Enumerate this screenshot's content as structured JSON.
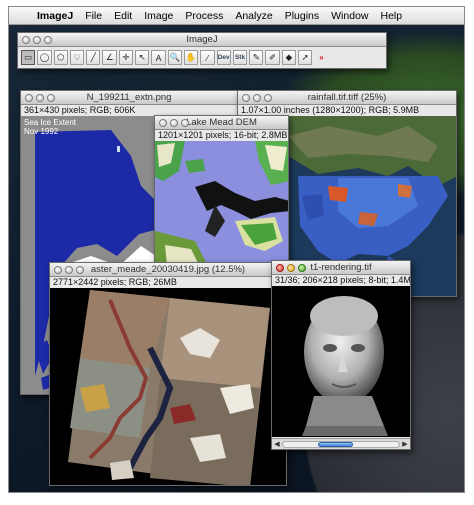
{
  "menubar": {
    "items": [
      "ImageJ",
      "File",
      "Edit",
      "Image",
      "Process",
      "Analyze",
      "Plugins",
      "Window",
      "Help"
    ]
  },
  "toolbar_window": {
    "title": "ImageJ",
    "tools": [
      {
        "name": "rectangle-tool-icon",
        "glyph": "▭",
        "selected": true
      },
      {
        "name": "oval-tool-icon",
        "glyph": "◯"
      },
      {
        "name": "polygon-tool-icon",
        "glyph": "⬠"
      },
      {
        "name": "freehand-tool-icon",
        "glyph": "♡"
      },
      {
        "name": "straight-line-tool-icon",
        "glyph": "╱"
      },
      {
        "name": "angle-tool-icon",
        "glyph": "∠"
      },
      {
        "name": "point-tool-icon",
        "glyph": "✛"
      },
      {
        "name": "wand-tool-icon",
        "glyph": "↖"
      },
      {
        "name": "text-tool-icon",
        "glyph": "A"
      },
      {
        "name": "magnifier-tool-icon",
        "glyph": "🔍"
      },
      {
        "name": "hand-tool-icon",
        "glyph": "✋"
      },
      {
        "name": "color-picker-icon",
        "glyph": "⁄"
      },
      {
        "name": "developer-menu-icon",
        "glyph": "Dev"
      },
      {
        "name": "stack-tools-icon",
        "glyph": "Stk"
      },
      {
        "name": "pencil-tool-icon",
        "glyph": "✎"
      },
      {
        "name": "brush-tool-icon",
        "glyph": "✐"
      },
      {
        "name": "flood-fill-icon",
        "glyph": "◆"
      },
      {
        "name": "arrow-tool-icon",
        "glyph": "➚"
      },
      {
        "name": "more-tools-icon",
        "glyph": "»"
      }
    ]
  },
  "windows": {
    "sea_ice": {
      "title": "N_199211_extn.png",
      "info": "361×430 pixels; RGB; 606K",
      "overlay_line1": "Sea Ice Extent",
      "overlay_line2": "Nov 1992"
    },
    "rainfall": {
      "title": "rainfall.tif.tiff (25%)",
      "info": "1.07×1.00 inches (1280×1200); RGB; 5.9MB"
    },
    "lake_mead": {
      "title": "Lake Mead DEM",
      "info": "1201×1201 pixels; 16-bit; 2.8MB"
    },
    "aster": {
      "title": "aster_meade_20030419.jpg (12.5%)",
      "info": "2771×2442 pixels; RGB; 26MB"
    },
    "t1": {
      "title": "t1-rendering.tif",
      "info": "31/36; 206×218 pixels; 8-bit; 1.4MB"
    }
  },
  "colors": {
    "sea_blue": "#1c2aa8",
    "land_gray": "#8a8a8a",
    "ice_white": "#ffffff",
    "accent_red": "#d0202a"
  }
}
